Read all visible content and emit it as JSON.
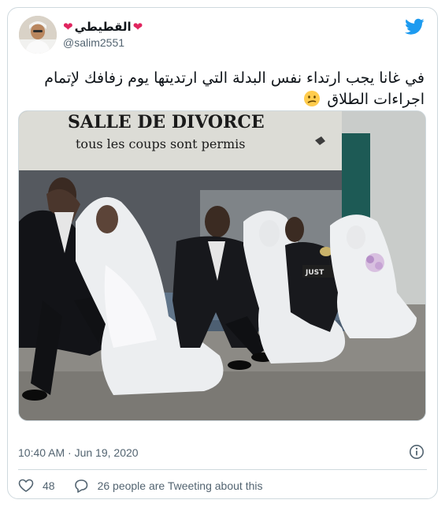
{
  "author": {
    "display_name": "القطيطي",
    "handle": "@salim2551"
  },
  "tweet": {
    "text": "في غانا يجب ارتداء نفس البدلة التي ارتديتها يوم زفافك لإتمام اجراءات الطلاق",
    "emoji": "confused-face-emoji",
    "photo_sign_line1": "SALLE DE DIVORCE",
    "photo_sign_line2": "tous les coups sont permis",
    "photo_car_sign": "JUST"
  },
  "meta": {
    "timestamp": "10:40 AM · Jun 19, 2020"
  },
  "engagement": {
    "likes": "48",
    "tweeting_about": "26 people are Tweeting about this"
  },
  "colors": {
    "brand": "#1d9bf0",
    "heart": "#e0245e",
    "text_secondary": "#536471",
    "border": "#cfd9de"
  }
}
